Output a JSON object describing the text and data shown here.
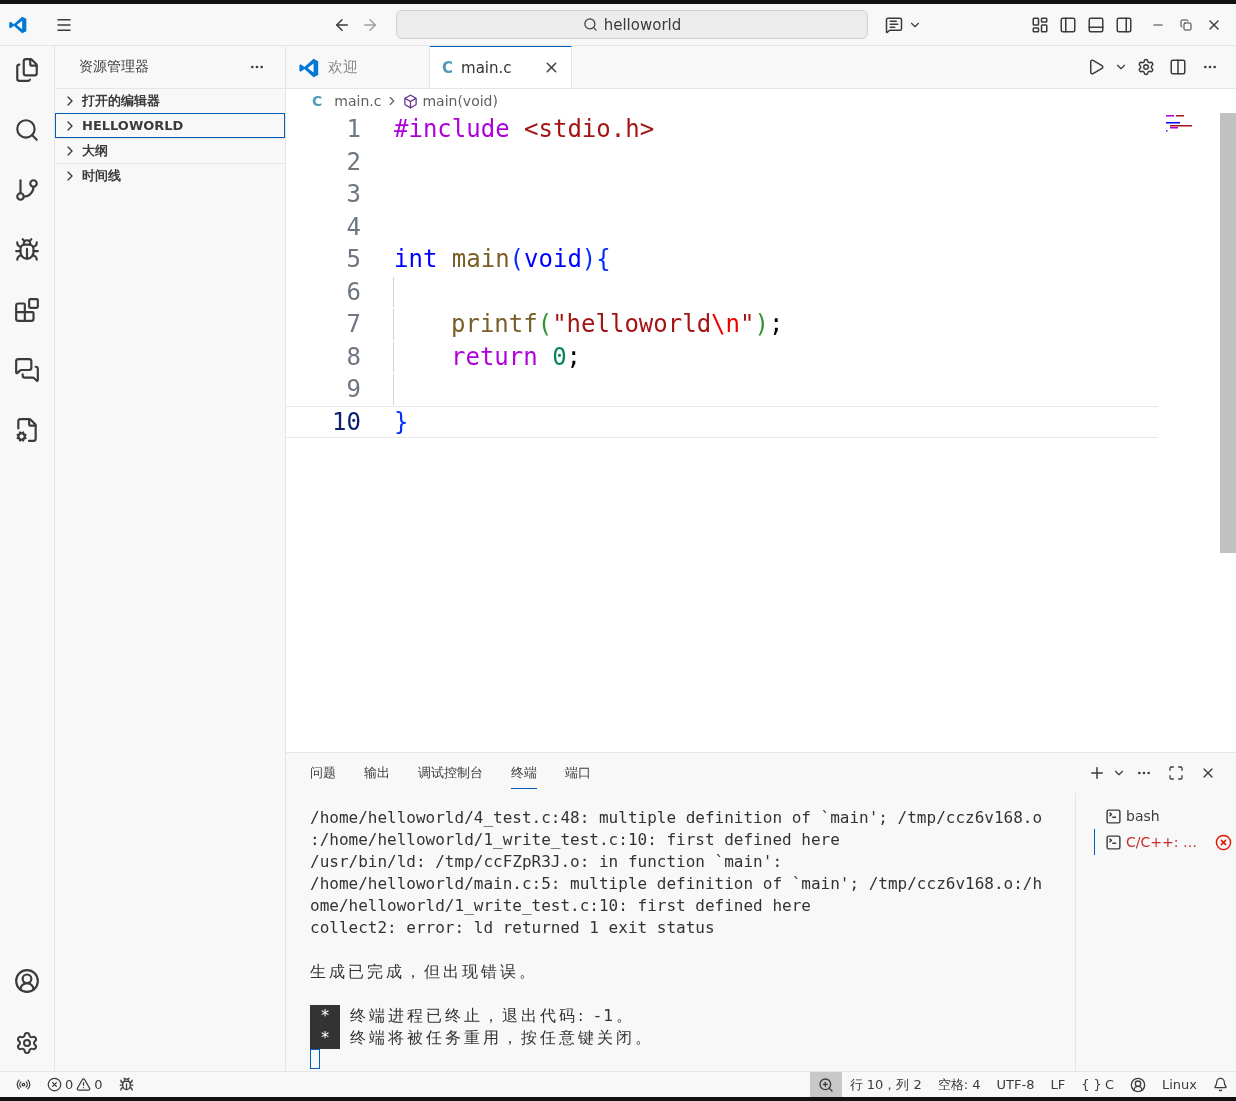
{
  "title_bar": {
    "search": "helloworld"
  },
  "sidebar": {
    "title": "资源管理器",
    "sections": [
      {
        "label": "打开的编辑器",
        "expanded": false,
        "selected": false
      },
      {
        "label": "HELLOWORLD",
        "expanded": false,
        "selected": true
      },
      {
        "label": "大纲",
        "expanded": false,
        "selected": false
      },
      {
        "label": "时间线",
        "expanded": false,
        "selected": false
      }
    ]
  },
  "tabs": [
    {
      "label": "欢迎",
      "kind": "welcome",
      "selected": false
    },
    {
      "label": "main.c",
      "kind": "c",
      "icon": "C",
      "selected": true
    }
  ],
  "breadcrumb": [
    {
      "label": "main.c",
      "kind": "file",
      "icon": "C"
    },
    {
      "label": "main(void)",
      "kind": "function"
    }
  ],
  "lines": [
    {
      "number": "1",
      "current": false,
      "indented": false,
      "tokens": [
        {
          "kind": "directive",
          "text": "#include"
        },
        {
          "kind": "string",
          "text": " <stdio.h>"
        }
      ]
    },
    {
      "number": "2",
      "current": false,
      "indented": false
    },
    {
      "number": "3",
      "current": false,
      "indented": false
    },
    {
      "number": "4",
      "current": false,
      "indented": false
    },
    {
      "number": "5",
      "current": false,
      "indented": false,
      "tokens": [
        {
          "kind": "keyword",
          "text": "int"
        },
        {
          "kind": "function",
          "text": " main"
        },
        {
          "kind": "bracket1",
          "text": "("
        },
        {
          "kind": "keyword",
          "text": "void"
        },
        {
          "kind": "bracket1",
          "text": "){"
        }
      ]
    },
    {
      "number": "6",
      "current": false,
      "indented": false
    },
    {
      "number": "7",
      "current": false,
      "indented": true,
      "tokens": [
        {
          "kind": "function",
          "text": "printf"
        },
        {
          "kind": "bracket2",
          "text": "("
        },
        {
          "kind": "string",
          "text": "\"helloworld"
        },
        {
          "kind": "escape",
          "text": "\\n"
        },
        {
          "kind": "string",
          "text": "\""
        },
        {
          "kind": "bracket2",
          "text": ")"
        },
        {
          "kind": "plain",
          "text": ";"
        }
      ]
    },
    {
      "number": "8",
      "current": false,
      "indented": true,
      "tokens": [
        {
          "kind": "control",
          "text": "return"
        },
        {
          "kind": "number",
          "text": " 0"
        },
        {
          "kind": "plain",
          "text": ";"
        }
      ]
    },
    {
      "number": "9",
      "current": false,
      "indented": false
    },
    {
      "number": "10",
      "current": true,
      "indented": false,
      "tokens": [
        {
          "kind": "bracket1",
          "text": "}"
        }
      ]
    }
  ],
  "panel": {
    "tabs": [
      {
        "label": "问题",
        "selected": false
      },
      {
        "label": "输出",
        "selected": false
      },
      {
        "label": "调试控制台",
        "selected": false
      },
      {
        "label": "终端",
        "selected": true
      },
      {
        "label": "端口",
        "selected": false
      }
    ],
    "output": [
      "/home/helloworld/4_test.c:48: multiple definition of `main'; /tmp/ccz6v168.o",
      ":/home/helloworld/1_write_test.c:10: first defined here",
      "/usr/bin/ld: /tmp/ccFZpR3J.o: in function `main':",
      "/home/helloworld/main.c:5: multiple definition of `main'; /tmp/ccz6v168.o:/h",
      "ome/helloworld/1_write_test.c:10: first defined here",
      "collect2: error: ld returned 1 exit status"
    ],
    "summary": "生成已完成，但出现错误。",
    "notices": [
      {
        "marker": "*",
        "text": "终端进程已终止，退出代码: -1。"
      },
      {
        "marker": "*",
        "text": "终端将被任务重用，按任意键关闭。"
      }
    ],
    "terminals": [
      {
        "label": "bash",
        "selected": false,
        "error": false
      },
      {
        "label": "C/C++: …",
        "selected": true,
        "error": true
      }
    ]
  },
  "status_bar": {
    "errors": "0",
    "warnings": "0",
    "position": "行 10，列 2",
    "indent": "空格: 4",
    "encoding": "UTF-8",
    "eol": "LF",
    "language_mode": "{ }",
    "language": "C",
    "platform": "Linux"
  }
}
